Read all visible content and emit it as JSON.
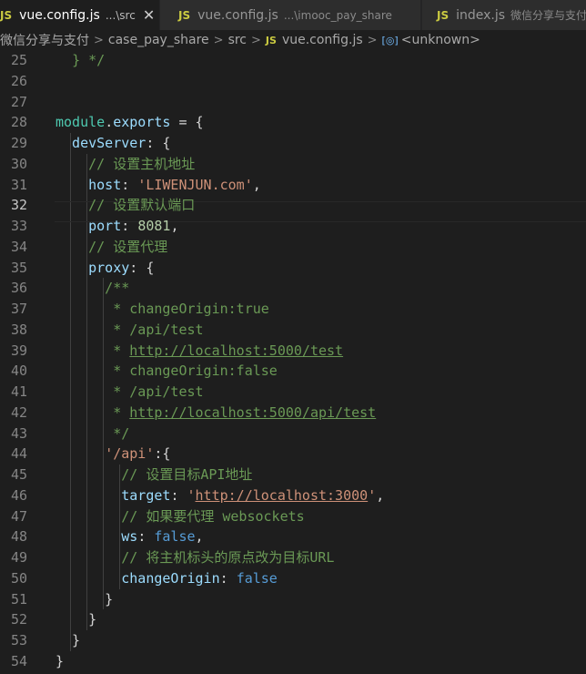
{
  "tabs": [
    {
      "icon": "JS",
      "name": "vue.config.js",
      "desc": "...\\src",
      "active": true,
      "close": "✕"
    },
    {
      "icon": "JS",
      "name": "vue.config.js",
      "desc": "...\\imooc_pay_share",
      "active": false
    },
    {
      "icon": "JS",
      "name": "index.js",
      "desc": "微信分享与支付",
      "active": false
    }
  ],
  "breadcrumb": {
    "items": [
      "微信分享与支付",
      "case_pay_share",
      "src",
      "vue.config.js",
      "<unknown>"
    ],
    "file_icon": "JS",
    "symbol_icon": "[◎]"
  },
  "editor": {
    "active_line": 32,
    "lines": [
      {
        "n": "25",
        "t": [
          [
            "  ",
            "p"
          ],
          [
            "} */",
            "c"
          ]
        ]
      },
      {
        "n": "26",
        "t": []
      },
      {
        "n": "27",
        "t": []
      },
      {
        "n": "28",
        "t": [
          [
            "module",
            "f"
          ],
          [
            ".",
            "p"
          ],
          [
            "exports",
            "k"
          ],
          [
            " = {",
            "p"
          ]
        ]
      },
      {
        "n": "29",
        "t": [
          [
            "  devServer",
            "k"
          ],
          [
            ": {",
            "p"
          ]
        ]
      },
      {
        "n": "30",
        "t": [
          [
            "    // 设置主机地址",
            "c"
          ]
        ]
      },
      {
        "n": "31",
        "t": [
          [
            "    host",
            "k"
          ],
          [
            ": ",
            "p"
          ],
          [
            "'LIWENJUN.com'",
            "s"
          ],
          [
            ",",
            "p"
          ]
        ]
      },
      {
        "n": "32",
        "t": [
          [
            "    // 设置默认端口",
            "c"
          ]
        ]
      },
      {
        "n": "33",
        "t": [
          [
            "    port",
            "k"
          ],
          [
            ": ",
            "p"
          ],
          [
            "8081",
            "n"
          ],
          [
            ",",
            "p"
          ]
        ]
      },
      {
        "n": "34",
        "t": [
          [
            "    // 设置代理",
            "c"
          ]
        ]
      },
      {
        "n": "35",
        "t": [
          [
            "    proxy",
            "k"
          ],
          [
            ": {",
            "p"
          ]
        ]
      },
      {
        "n": "36",
        "t": [
          [
            "      /**",
            "c"
          ]
        ]
      },
      {
        "n": "37",
        "t": [
          [
            "       * changeOrigin:true",
            "c"
          ]
        ]
      },
      {
        "n": "38",
        "t": [
          [
            "       * /api/test",
            "c"
          ]
        ]
      },
      {
        "n": "39",
        "t": [
          [
            "       * ",
            "c"
          ],
          [
            "http://localhost:5000/test",
            "cu"
          ]
        ]
      },
      {
        "n": "40",
        "t": [
          [
            "       * changeOrigin:false",
            "c"
          ]
        ]
      },
      {
        "n": "41",
        "t": [
          [
            "       * /api/test",
            "c"
          ]
        ]
      },
      {
        "n": "42",
        "t": [
          [
            "       * ",
            "c"
          ],
          [
            "http://localhost:5000/api/test",
            "cu"
          ]
        ]
      },
      {
        "n": "43",
        "t": [
          [
            "       */",
            "c"
          ]
        ]
      },
      {
        "n": "44",
        "t": [
          [
            "      ",
            "p"
          ],
          [
            "'/api'",
            "s"
          ],
          [
            ":{",
            "p"
          ]
        ]
      },
      {
        "n": "45",
        "t": [
          [
            "        // 设置目标API地址",
            "c"
          ]
        ]
      },
      {
        "n": "46",
        "t": [
          [
            "        target",
            "k"
          ],
          [
            ": ",
            "p"
          ],
          [
            "'",
            "s"
          ],
          [
            "http://localhost:3000",
            "su"
          ],
          [
            "'",
            "s"
          ],
          [
            ",",
            "p"
          ]
        ]
      },
      {
        "n": "47",
        "t": [
          [
            "        // 如果要代理 websockets",
            "c"
          ]
        ]
      },
      {
        "n": "48",
        "t": [
          [
            "        ws",
            "k"
          ],
          [
            ": ",
            "p"
          ],
          [
            "false",
            "b"
          ],
          [
            ",",
            "p"
          ]
        ]
      },
      {
        "n": "49",
        "t": [
          [
            "        // 将主机标头的原点改为目标URL",
            "c"
          ]
        ]
      },
      {
        "n": "50",
        "t": [
          [
            "        changeOrigin",
            "k"
          ],
          [
            ": ",
            "p"
          ],
          [
            "false",
            "b"
          ]
        ]
      },
      {
        "n": "51",
        "t": [
          [
            "      }",
            "p"
          ]
        ]
      },
      {
        "n": "52",
        "t": [
          [
            "    }",
            "p"
          ]
        ]
      },
      {
        "n": "53",
        "t": [
          [
            "  }",
            "p"
          ]
        ]
      },
      {
        "n": "54",
        "t": [
          [
            "}",
            "p"
          ]
        ]
      }
    ]
  }
}
